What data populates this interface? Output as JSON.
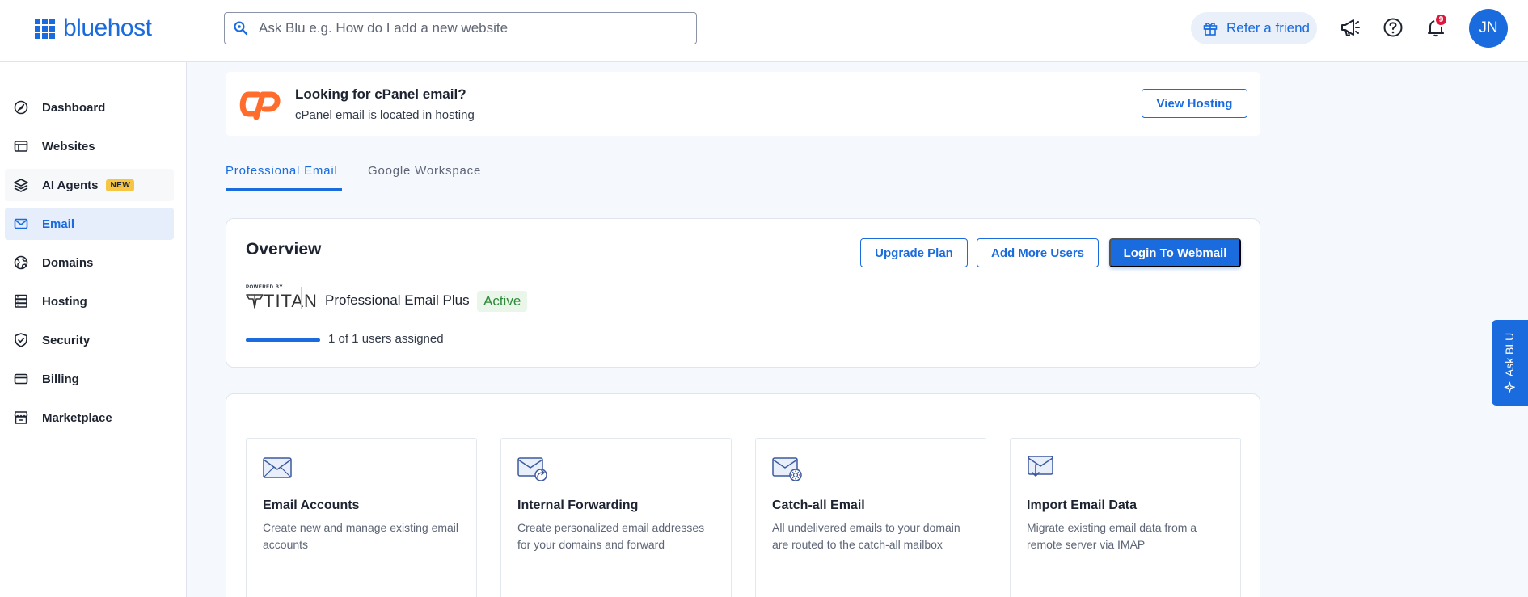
{
  "header": {
    "brand": "bluehost",
    "search_placeholder": "Ask Blu e.g. How do I add a new website",
    "refer_label": "Refer a friend",
    "notification_count": "9",
    "user_initials": "JN"
  },
  "sidebar": {
    "items": [
      {
        "label": "Dashboard"
      },
      {
        "label": "Websites"
      },
      {
        "label": "AI Agents",
        "tag": "NEW"
      },
      {
        "label": "Email"
      },
      {
        "label": "Domains"
      },
      {
        "label": "Hosting"
      },
      {
        "label": "Security"
      },
      {
        "label": "Billing"
      },
      {
        "label": "Marketplace"
      }
    ]
  },
  "cpanel_banner": {
    "title": "Looking for cPanel email?",
    "subtitle": "cPanel email is located in hosting",
    "button": "View Hosting"
  },
  "tabs": [
    {
      "label": "Professional Email"
    },
    {
      "label": "Google Workspace"
    }
  ],
  "overview": {
    "title": "Overview",
    "buttons": {
      "upgrade": "Upgrade Plan",
      "add_users": "Add More Users",
      "login": "Login To Webmail"
    },
    "powered_by": "POWERED BY",
    "provider": "TITAN",
    "plan_name": "Professional Email Plus",
    "status": "Active",
    "users_text": "1 of 1 users assigned",
    "users_assigned_fraction": 1.0
  },
  "features": [
    {
      "title": "Email Accounts",
      "description": "Create new and manage existing email accounts",
      "icon": "envelope-icon"
    },
    {
      "title": "Internal Forwarding",
      "description": "Create personalized email addresses for your domains and forward",
      "icon": "forward-envelope-icon"
    },
    {
      "title": "Catch-all Email",
      "description": "All undelivered emails to your domain are routed to the catch-all mailbox",
      "icon": "gear-envelope-icon"
    },
    {
      "title": "Import Email Data",
      "description": "Migrate existing email data from a remote server via IMAP",
      "icon": "import-envelope-icon"
    }
  ],
  "ask_blu": {
    "label": "Ask BLU"
  },
  "colors": {
    "brand_blue": "#196bde",
    "badge_red": "#e0173c",
    "new_tag_yellow": "#f7c544",
    "active_green": "#2f8a3a",
    "cpanel_orange": "#ff6c2c"
  }
}
